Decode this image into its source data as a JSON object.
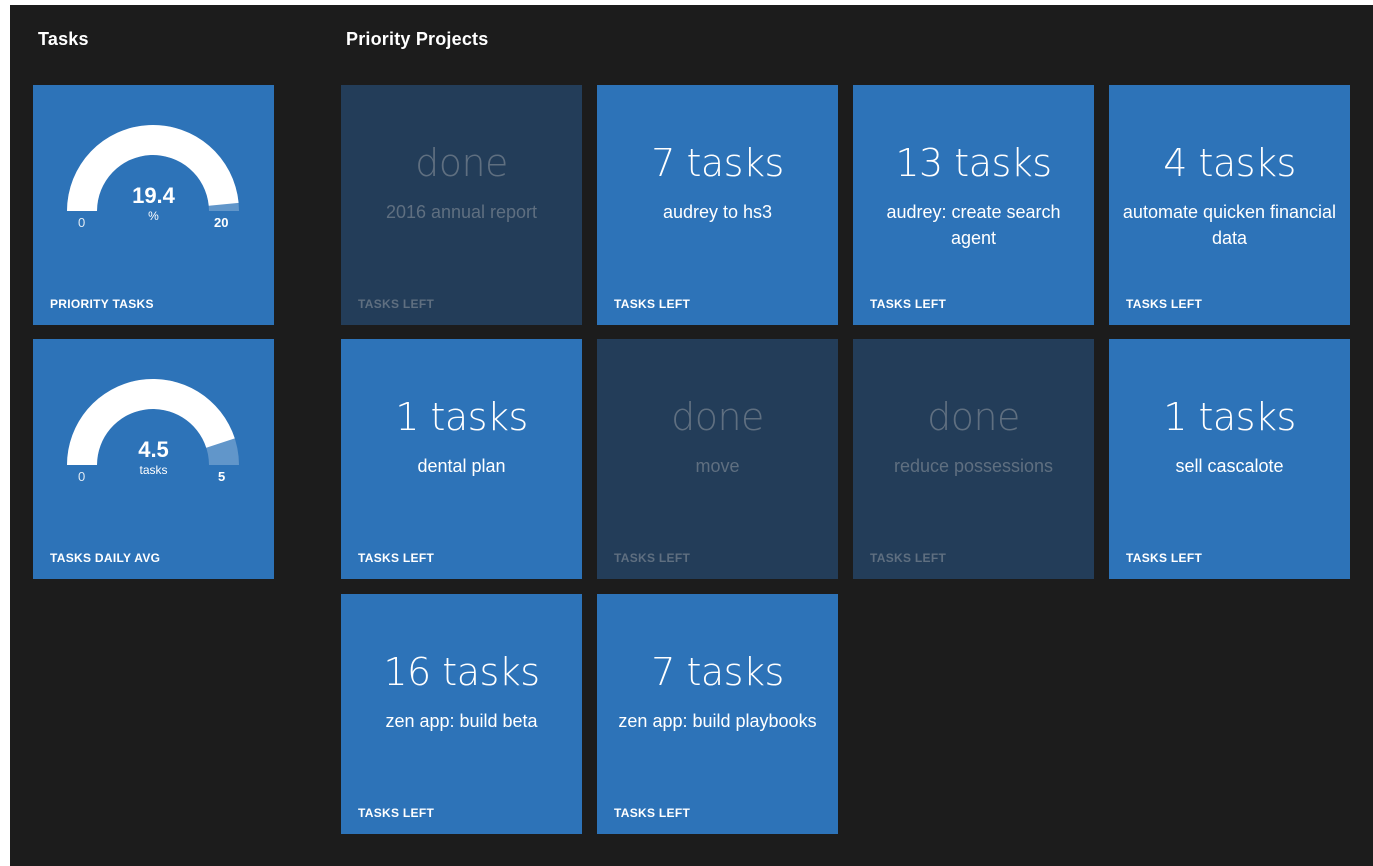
{
  "sections": {
    "tasks_title": "Tasks",
    "projects_title": "Priority Projects"
  },
  "gauges": [
    {
      "value": "19.4",
      "unit": "%",
      "min": "0",
      "max": "20",
      "fraction": 0.97,
      "label": "PRIORITY TASKS"
    },
    {
      "value": "4.5",
      "unit": "tasks",
      "min": "0",
      "max": "5",
      "fraction": 0.9,
      "label": "TASKS DAILY AVG"
    }
  ],
  "projects": [
    {
      "count": "done",
      "name": "2016 annual report",
      "label": "TASKS LEFT",
      "done": true
    },
    {
      "count": "7 tasks",
      "name": "audrey to hs3",
      "label": "TASKS LEFT",
      "done": false
    },
    {
      "count": "13 tasks",
      "name": "audrey: create search agent",
      "label": "TASKS LEFT",
      "done": false
    },
    {
      "count": "4 tasks",
      "name": "automate quicken financial data",
      "label": "TASKS LEFT",
      "done": false
    },
    {
      "count": "1 tasks",
      "name": "dental plan",
      "label": "TASKS LEFT",
      "done": false
    },
    {
      "count": "done",
      "name": "move",
      "label": "TASKS LEFT",
      "done": true
    },
    {
      "count": "done",
      "name": "reduce possessions",
      "label": "TASKS LEFT",
      "done": true
    },
    {
      "count": "1 tasks",
      "name": "sell cascalote",
      "label": "TASKS LEFT",
      "done": false
    },
    {
      "count": "16 tasks",
      "name": "zen app: build beta",
      "label": "TASKS LEFT",
      "done": false
    },
    {
      "count": "7 tasks",
      "name": "zen app: build playbooks",
      "label": "TASKS LEFT",
      "done": false
    }
  ],
  "colors": {
    "tile_active": "#2d73b8",
    "tile_done": "#233d59",
    "background": "#1c1c1c",
    "gauge_fill": "#ffffff"
  }
}
